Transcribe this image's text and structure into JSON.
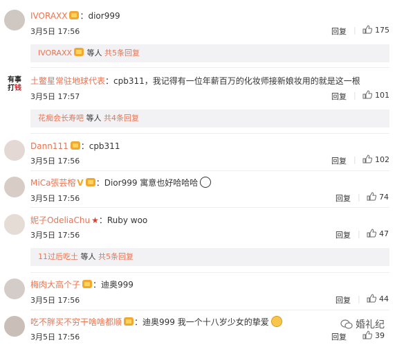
{
  "comments": [
    {
      "user": "IVORAXX",
      "text": "：dior999",
      "date": "3月5日 17:56",
      "reply": "回复",
      "likes": "175"
    },
    {
      "user": "土鳖星常驻地球代表",
      "text": "：cpb311，我记得有一位年薪百万的化妆师接新娘妆用的就是这一根",
      "date": "3月5日 17:57",
      "reply": "回复",
      "likes": "101",
      "avatar_line1": "有事",
      "avatar_line2a": "打",
      "avatar_line2b": "钱"
    },
    {
      "user": "Dann111",
      "text": "：cpb311",
      "date": "3月5日 17:56",
      "reply": "回复",
      "likes": "102"
    },
    {
      "user": "MiCa張芸榕",
      "text": "：Dior999 寓意也好哈哈哈",
      "date": "3月5日 17:56",
      "reply": "回复",
      "likes": "74"
    },
    {
      "user": "妮子OdeliaChu",
      "text": "：Ruby woo",
      "date": "3月5日 17:56",
      "reply": "回复",
      "likes": "47"
    },
    {
      "user": "梅肉大高个子",
      "text": "：迪奥999",
      "date": "3月5日 17:56",
      "reply": "回复",
      "likes": "44"
    },
    {
      "user": "吃不胖买不穷干啥啥都顺",
      "text": "：迪奥999 我一个十八岁少女的挚爱",
      "date": "3月5日 17:56",
      "reply": "回复",
      "likes": "39"
    }
  ],
  "subreplies": [
    {
      "user": "IVORAXX",
      "mid": " 等人 ",
      "more": "共5条回复"
    },
    {
      "user": "花痴会长寿吧",
      "mid": " 等人 ",
      "more": "共4条回复"
    },
    {
      "user": "11过后吃土",
      "mid": " 等人 ",
      "more": "共5条回复"
    }
  ],
  "watermark": "婚礼纪",
  "colors": {
    "username": "#eb7350",
    "subbox_bg": "#f2f2f5",
    "badge": "#f2a830"
  }
}
